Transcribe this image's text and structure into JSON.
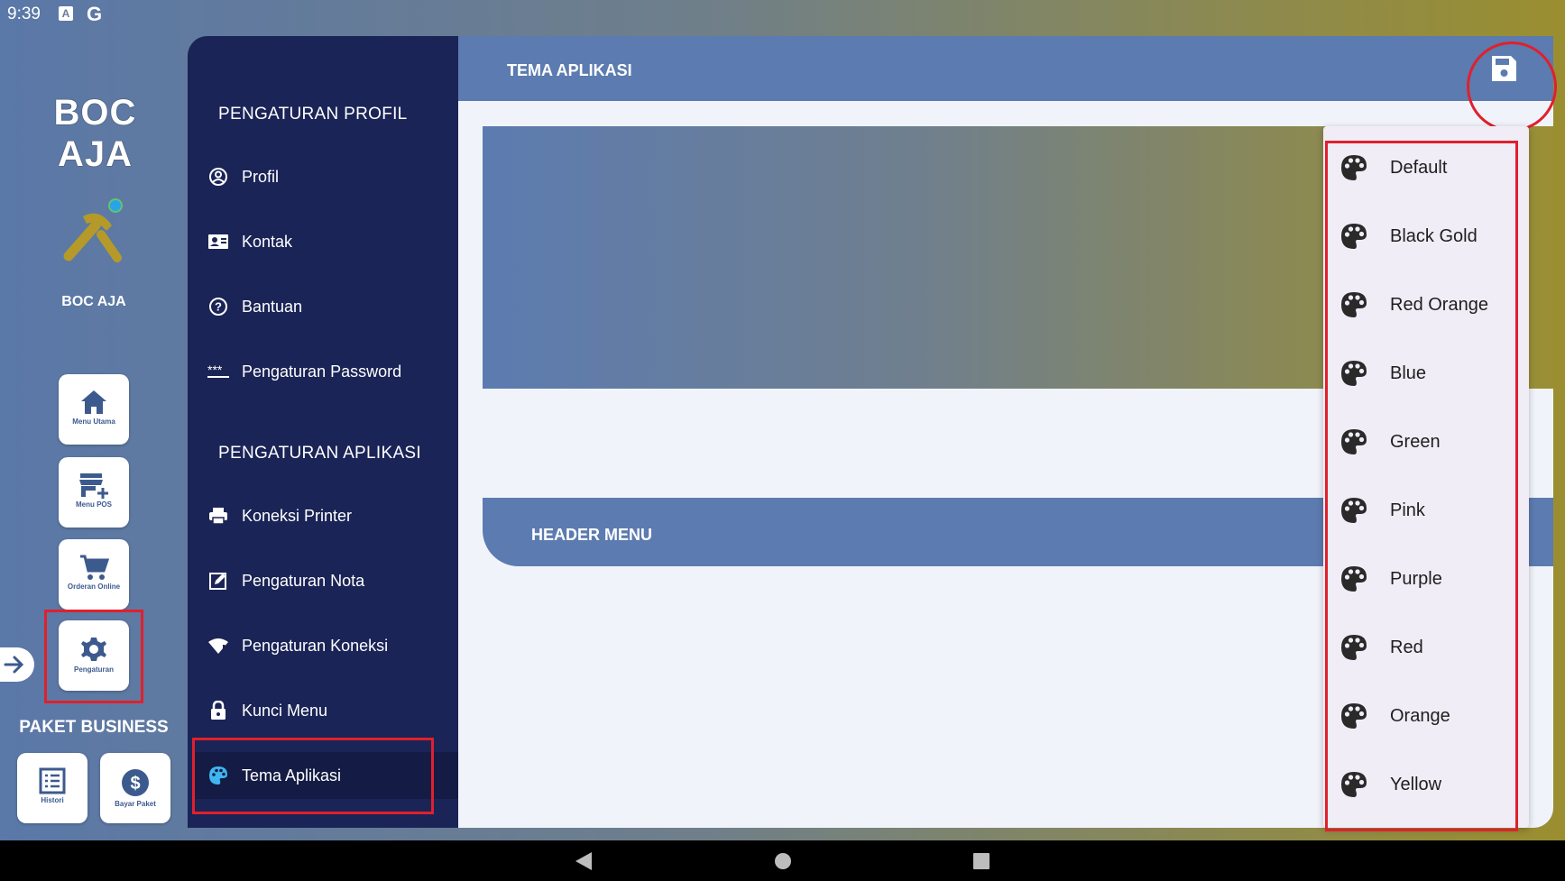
{
  "status_bar": {
    "time": "9:39",
    "icons": [
      "a-icon",
      "google-icon"
    ]
  },
  "rail": {
    "logo_text": "BOC AJA",
    "user_name": "BOC AJA",
    "buttons": [
      {
        "label": "Menu Utama",
        "icon": "home-icon"
      },
      {
        "label": "Menu POS",
        "icon": "store-add-icon"
      },
      {
        "label": "Orderan Online",
        "icon": "cart-icon"
      },
      {
        "label": "Pengaturan",
        "icon": "gear-icon"
      }
    ],
    "paket": "PAKET BUSINESS",
    "bottom_buttons": [
      {
        "label": "Histori",
        "icon": "list-icon"
      },
      {
        "label": "Bayar Paket",
        "icon": "dollar-icon"
      }
    ]
  },
  "menu": {
    "profile_section": "PENGATURAN PROFIL",
    "profile_items": [
      {
        "label": "Profil",
        "icon": "account-circle-icon"
      },
      {
        "label": "Kontak",
        "icon": "contact-card-icon"
      },
      {
        "label": "Bantuan",
        "icon": "help-icon"
      },
      {
        "label": "Pengaturan Password",
        "icon": "password-icon"
      }
    ],
    "app_section": "PENGATURAN APLIKASI",
    "app_items": [
      {
        "label": "Koneksi Printer",
        "icon": "printer-icon"
      },
      {
        "label": "Pengaturan Nota",
        "icon": "edit-note-icon"
      },
      {
        "label": "Pengaturan Koneksi",
        "icon": "wifi-alert-icon"
      },
      {
        "label": "Kunci Menu",
        "icon": "lock-icon"
      },
      {
        "label": "Tema Aplikasi",
        "icon": "palette-icon",
        "active": true
      }
    ]
  },
  "content": {
    "title": "TEMA APLIKASI",
    "header_menu_label": "HEADER MENU"
  },
  "theme_options": [
    "Default",
    "Black Gold",
    "Red Orange",
    "Blue",
    "Green",
    "Pink",
    "Purple",
    "Red",
    "Orange",
    "Yellow"
  ],
  "colors": {
    "accent": "#5c7bb0",
    "menu_bg": "#1a2456",
    "highlight": "#e0202c",
    "active_icon": "#3fb6f0"
  }
}
